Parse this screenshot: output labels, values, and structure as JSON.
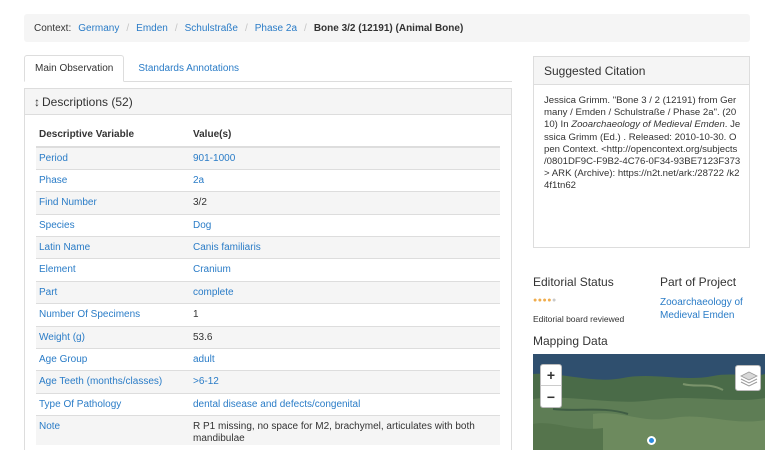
{
  "breadcrumb": {
    "context_label": "Context:",
    "items": [
      "Germany",
      "Emden",
      "Schulstraße",
      "Phase 2a"
    ],
    "current": "Bone 3/2 (12191) (Animal Bone)"
  },
  "tabs": [
    {
      "label": "Main Observation",
      "active": true
    },
    {
      "label": "Standards Annotations",
      "active": false
    }
  ],
  "descriptions": {
    "heading": "Descriptions (52)",
    "columns": [
      "Descriptive Variable",
      "Value(s)"
    ],
    "rows": [
      {
        "variable": "Period",
        "value": "901-1000",
        "link": true
      },
      {
        "variable": "Phase",
        "value": "2a",
        "link": true
      },
      {
        "variable": "Find Number",
        "value": "3/2",
        "link": false
      },
      {
        "variable": "Species",
        "value": "Dog",
        "link": true
      },
      {
        "variable": "Latin Name",
        "value": "Canis familiaris",
        "link": true
      },
      {
        "variable": "Element",
        "value": "Cranium",
        "link": true
      },
      {
        "variable": "Part",
        "value": "complete",
        "link": true
      },
      {
        "variable": "Number Of Specimens",
        "value": "1",
        "link": false
      },
      {
        "variable": "Weight (g)",
        "value": "53.6",
        "link": false
      },
      {
        "variable": "Age Group",
        "value": "adult",
        "link": true
      },
      {
        "variable": "Age Teeth (months/classes)",
        "value": ">6-12",
        "link": true
      },
      {
        "variable": "Type Of Pathology",
        "value": "dental disease and defects/congenital",
        "link": true
      },
      {
        "variable": "Note",
        "value": "R P1 missing, no space for M2, brachymel, articulates with both mandibulae",
        "link": false
      }
    ]
  },
  "citation": {
    "heading": "Suggested Citation",
    "part1": "Jessica Grimm. \"Bone 3 / 2 (12191) from Germany / Emden / Schulstraße / Phase 2a\". (2010) In ",
    "title": "Zooarchaeology of Medieval Emden",
    "part2": ". Jessica Grimm (Ed.) . Released: 2010-10-30. Open Context. <http://opencontext.org/subjects /0801DF9C-F9B2-4C76-0F34-93BE7123F373> ARK (Archive): https://n2t.net/ark:/28722 /k24f1tn62"
  },
  "editorial": {
    "heading": "Editorial Status",
    "stars_filled": 4,
    "stars_total": 5,
    "status": "Editorial board reviewed"
  },
  "project": {
    "heading": "Part of Project",
    "name": "Zooarchaeology of Medieval Emden"
  },
  "mapping": {
    "heading": "Mapping Data",
    "zoom_in": "+",
    "zoom_out": "−"
  },
  "colors": {
    "link": "#2a7cc7",
    "star": "#f0ad4e",
    "marker": "#2a8be0"
  }
}
